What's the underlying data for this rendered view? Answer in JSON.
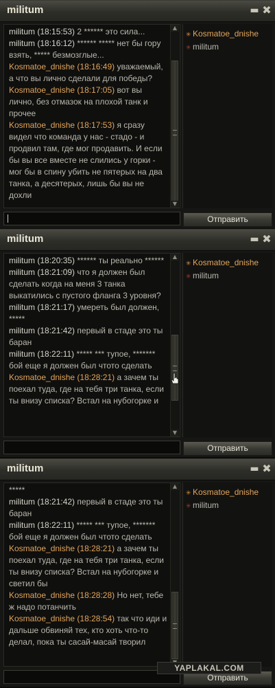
{
  "windows": [
    {
      "title": "militum",
      "send_label": "Отправить",
      "users": [
        {
          "name": "Kosmatoe_dnishe",
          "style": "k"
        },
        {
          "name": "militum",
          "style": "m"
        }
      ],
      "messages": [
        {
          "name": "militum",
          "time": "(18:15:53)",
          "text": "2 ****** это сила...",
          "style": "m"
        },
        {
          "name": "militum",
          "time": "(18:16:12)",
          "text": "****** ***** нет бы горy взять, ***** безмозглые...",
          "style": "m"
        },
        {
          "name": "Kosmatoe_dnishe",
          "time": "(18:16:49)",
          "text": "уважаемый, а что вы лично сделали для победы?",
          "style": "k"
        },
        {
          "name": "Kosmatoe_dnishe",
          "time": "(18:17:05)",
          "text": "вот вы лично, без отмазок на плохой танк и прочее",
          "style": "k"
        },
        {
          "name": "Kosmatoe_dnishe",
          "time": "(18:17:53)",
          "text": "я сразу видел что команда у нас - стадо - и продвил там, где мог продавить. И если бы вы все вместе не слились у горки - мог бы в спину убить не пятерых на два танка, а десятерых, лишь бы вы не дохли",
          "style": "k"
        }
      ]
    },
    {
      "title": "militum",
      "send_label": "Отправить",
      "users": [
        {
          "name": "Kosmatoe_dnishe",
          "style": "k"
        },
        {
          "name": "militum",
          "style": "m"
        }
      ],
      "messages": [
        {
          "name": "militum",
          "time": "(18:20:35)",
          "text": "****** ты реально ******",
          "style": "m"
        },
        {
          "name": "militum",
          "time": "(18:21:09)",
          "text": "что я должен был сделать когда на меня 3 танка выкатились с пустого фланга 3 уровня?",
          "style": "m"
        },
        {
          "name": "militum",
          "time": "(18:21:17)",
          "text": "умереть был должен, *****",
          "style": "m"
        },
        {
          "name": "militum",
          "time": "(18:21:42)",
          "text": "первый в стаде это ты баран",
          "style": "m"
        },
        {
          "name": "militum",
          "time": "(18:22:11)",
          "text": "***** *** тупое, ******* бой еще я должен был чтото сделать",
          "style": "m"
        },
        {
          "name": "Kosmatoe_dnishe",
          "time": "(18:28:21)",
          "text": "а зачем ты поехал туда, где на тебя три танка, если ты внизу списка? Встал на нубогорке и",
          "style": "k"
        }
      ]
    },
    {
      "title": "militum",
      "send_label": "Отправить",
      "users": [
        {
          "name": "Kosmatoe_dnishe",
          "style": "k"
        },
        {
          "name": "militum",
          "style": "m"
        }
      ],
      "messages": [
        {
          "name": "",
          "time": "",
          "text": "*****",
          "style": "m"
        },
        {
          "name": "militum",
          "time": "(18:21:42)",
          "text": "первый в стаде это ты баран",
          "style": "m"
        },
        {
          "name": "militum",
          "time": "(18:22:11)",
          "text": "***** *** тупое, ******* бой еще я должен был чтото сделать",
          "style": "m"
        },
        {
          "name": "Kosmatoe_dnishe",
          "time": "(18:28:21)",
          "text": "а зачем ты поехал туда, где на тебя три танка, если ты внизу списка? Встал на нубогорке и светил бы",
          "style": "k"
        },
        {
          "name": "Kosmatoe_dnishe",
          "time": "(18:28:28)",
          "text": "Но нет, тебе ж надо потанчить",
          "style": "k"
        },
        {
          "name": "Kosmatoe_dnishe",
          "time": "(18:28:54)",
          "text": "так что иди и дальше обвиняй тех, кто хоть что-то делал, пока ты сасай-масай творил",
          "style": "k"
        }
      ]
    }
  ],
  "watermark": "YAPLAKAL.COM"
}
